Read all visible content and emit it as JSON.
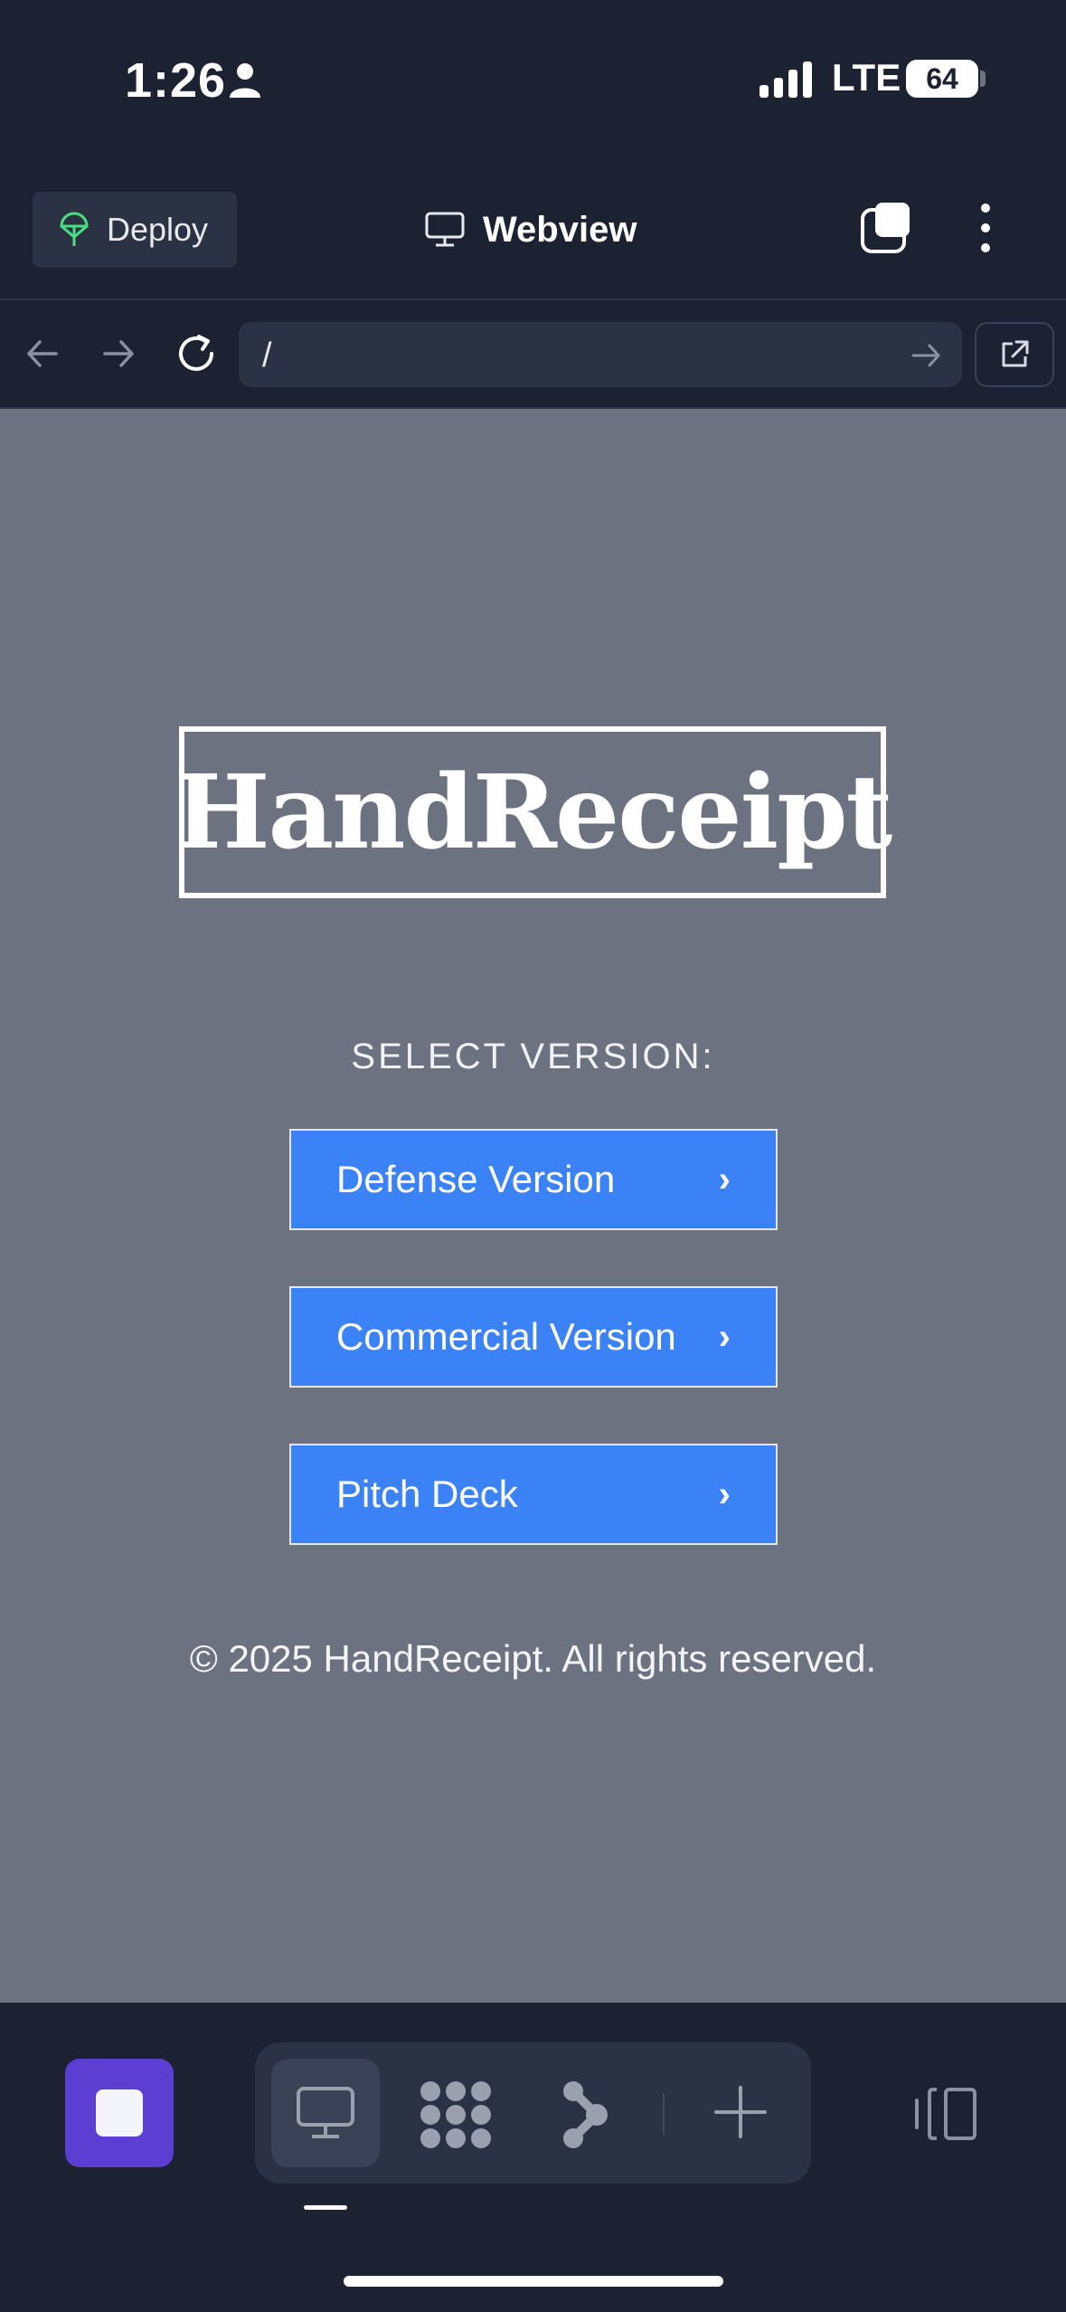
{
  "status_bar": {
    "time": "1:26",
    "network": "LTE",
    "battery_level": "64",
    "icons": [
      "person-icon",
      "signal-bars-icon",
      "battery-icon"
    ]
  },
  "top_bar": {
    "deploy_label": "Deploy",
    "title": "Webview",
    "icons": [
      "deploy-icon",
      "monitor-icon",
      "tabs-icon",
      "more-vertical-icon"
    ]
  },
  "browser": {
    "url": "/",
    "icons": [
      "back-arrow-icon",
      "forward-arrow-icon",
      "reload-icon",
      "go-arrow-icon",
      "external-link-icon"
    ]
  },
  "page": {
    "logo": "HandReceipt",
    "select_label": "SELECT VERSION:",
    "buttons": [
      {
        "label": "Defense Version",
        "chevron": "›"
      },
      {
        "label": "Commercial Version",
        "chevron": "›"
      },
      {
        "label": "Pitch Deck",
        "chevron": "›"
      }
    ],
    "copyright": "© 2025 HandReceipt. All rights reserved.",
    "colors": {
      "background": "#6c7280",
      "button": "#3b82f6"
    }
  },
  "bottom_bar": {
    "icons": [
      "stop-icon",
      "webview-monitor-icon",
      "grid-dots-icon",
      "branch-icon",
      "plus-icon",
      "side-panel-icon"
    ],
    "accent": "#5b3fd3"
  }
}
